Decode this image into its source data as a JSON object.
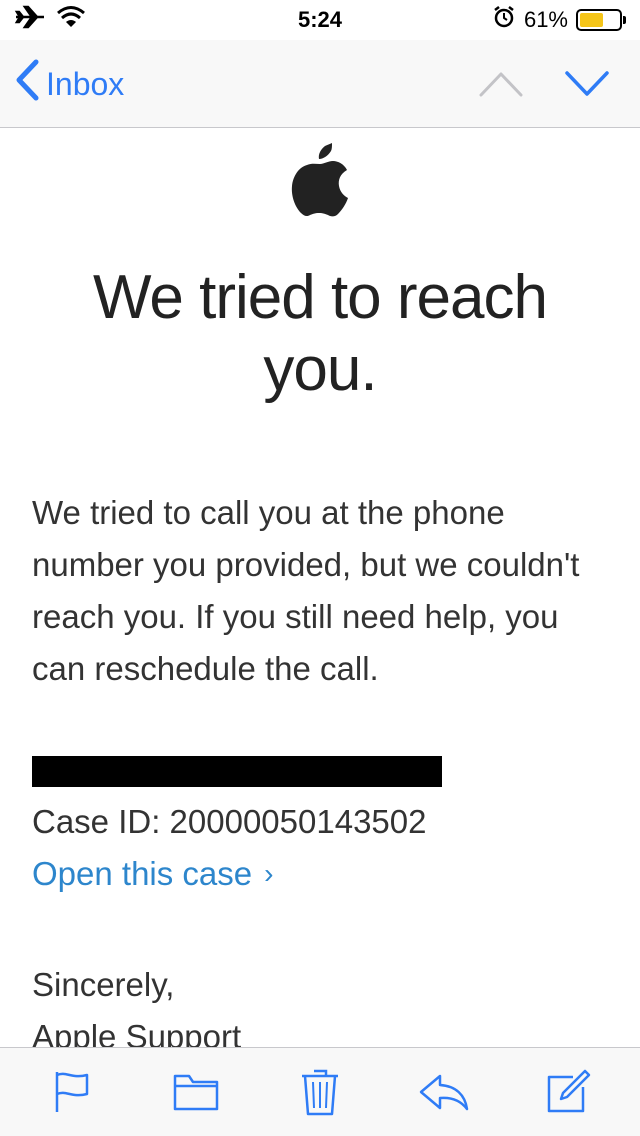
{
  "status_bar": {
    "time": "5:24",
    "battery_percent": "61%",
    "battery_level": 0.61,
    "icons": [
      "airplane-icon",
      "wifi-icon",
      "alarm-icon",
      "battery-icon"
    ]
  },
  "nav": {
    "back_label": "Inbox",
    "accent_color": "#2f7cf6"
  },
  "email": {
    "headline_line1": "We tried to reach",
    "headline_line2": "you.",
    "paragraph": "We tried to call you at the phone number you provided, but we couldn't reach you. If you still need help, you can reschedule the call.",
    "case_id": "Case ID: 20000050143502",
    "open_case_link": "Open this case",
    "open_case_chevron": "›",
    "signoff_line1": "Sincerely,",
    "signoff_line2": "Apple Support",
    "link_color": "#2d86cc"
  },
  "toolbar": {
    "icons": [
      "flag-icon",
      "folder-icon",
      "trash-icon",
      "reply-icon",
      "compose-icon"
    ]
  }
}
